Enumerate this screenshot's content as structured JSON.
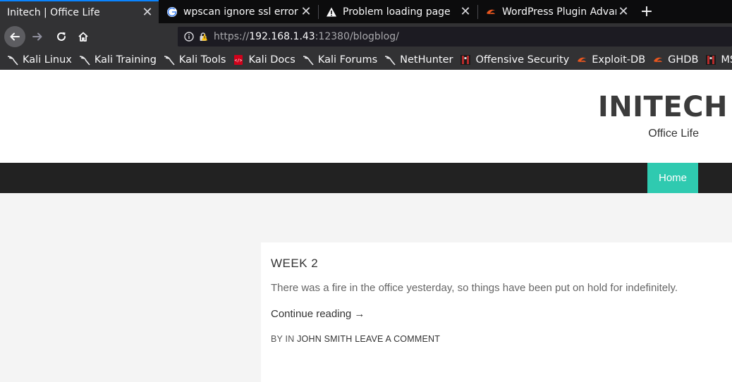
{
  "browser": {
    "tabs": [
      {
        "title": "Initech | Office Life",
        "icon": "none",
        "active": true
      },
      {
        "title": "wpscan ignore ssl error -",
        "icon": "google-icon",
        "active": false
      },
      {
        "title": "Problem loading page",
        "icon": "warning-icon",
        "active": false
      },
      {
        "title": "WordPress Plugin Advanc",
        "icon": "exploit-db-icon",
        "active": false
      }
    ],
    "close_glyph": "✕",
    "new_tab_glyph": "+",
    "url": {
      "scheme": "https://",
      "host": "192.168.1.43",
      "rest": ":12380/blogblog/"
    },
    "bookmarks": [
      {
        "label": "Kali Linux",
        "icon": "kali-icon"
      },
      {
        "label": "Kali Training",
        "icon": "kali-icon"
      },
      {
        "label": "Kali Tools",
        "icon": "kali-icon"
      },
      {
        "label": "Kali Docs",
        "icon": "kali-docs-icon"
      },
      {
        "label": "Kali Forums",
        "icon": "kali-icon"
      },
      {
        "label": "NetHunter",
        "icon": "kali-icon"
      },
      {
        "label": "Offensive Security",
        "icon": "offsec-icon"
      },
      {
        "label": "Exploit-DB",
        "icon": "exploit-db-icon"
      },
      {
        "label": "GHDB",
        "icon": "exploit-db-icon"
      },
      {
        "label": "MSFU",
        "icon": "offsec-icon"
      }
    ]
  },
  "site": {
    "title": "INITECH",
    "description": "Office Life",
    "nav": {
      "home": "Home"
    }
  },
  "post": {
    "title": "WEEK 2",
    "excerpt": "There was a fire in the office yesterday, so things have been put on hold for indefinitely.",
    "more": "Continue reading →",
    "meta_prefix": "BY IN",
    "author": "JOHN SMITH",
    "comment": "LEAVE A COMMENT"
  },
  "colors": {
    "accent": "#2fcab0",
    "nav_bg": "#222222",
    "tab_accent": "#0a84ff"
  }
}
